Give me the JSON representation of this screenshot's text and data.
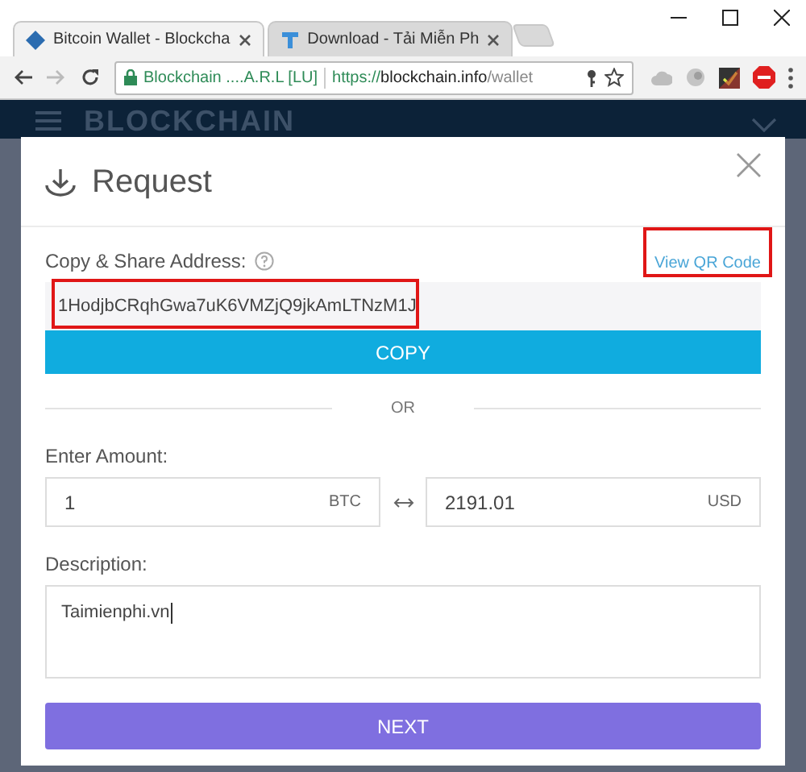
{
  "browser": {
    "tabs": [
      {
        "title": "Bitcoin Wallet - Blockcha",
        "selected": true
      },
      {
        "title": "Download - Tải Miễn Ph",
        "selected": false
      }
    ],
    "security_label": "Blockchain ....A.R.L [LU]",
    "url": {
      "scheme": "https://",
      "host": "blockchain.info",
      "path": "/wallet"
    }
  },
  "page_header": {
    "brand": "BLOCKCHAIN"
  },
  "modal": {
    "title": "Request",
    "address_label": "Copy & Share Address:",
    "qr_link": "View QR Code",
    "address": "1HodjbCRqhGwa7uK6VMZjQ9jkAmLTNzM1J",
    "copy_button": "COPY",
    "separator": "OR",
    "amount_label": "Enter Amount:",
    "amount": {
      "value": "1",
      "unit": "BTC"
    },
    "fiat": {
      "value": "2191.01",
      "unit": "USD"
    },
    "description_label": "Description:",
    "description": "Taimienphi.vn",
    "next_button": "NEXT"
  }
}
